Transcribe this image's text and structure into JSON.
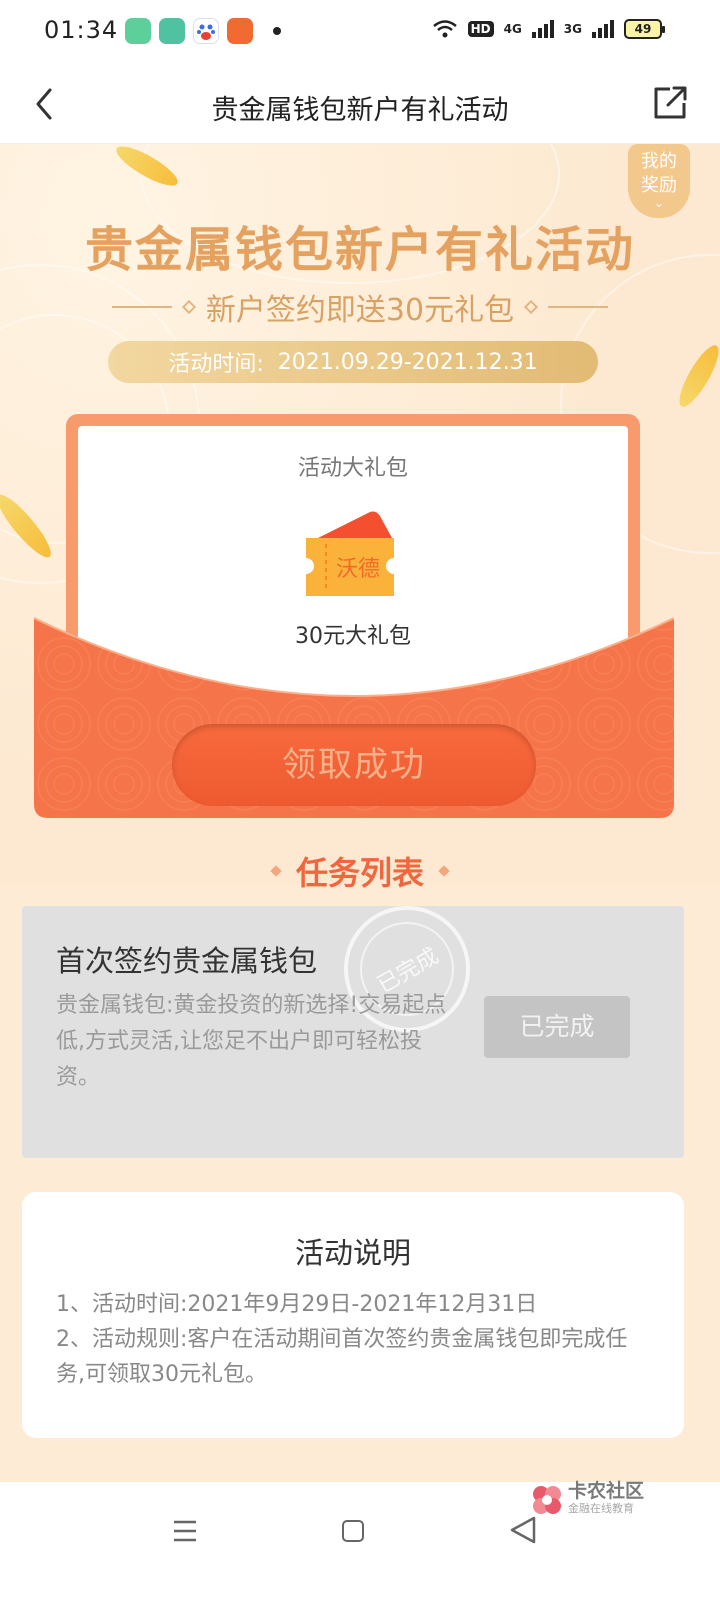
{
  "status_bar": {
    "time": "01:34",
    "hd": "HD",
    "net1": "4G",
    "net2": "3G",
    "battery": "49"
  },
  "title_bar": {
    "title": "贵金属钱包新户有礼活动"
  },
  "hero": {
    "my_reward": "我的奖励",
    "title": "贵金属钱包新户有礼活动",
    "subtitle": "新户签约即送30元礼包",
    "date_label": "活动时间:",
    "date_range": "2021.09.29-2021.12.31"
  },
  "gift_card": {
    "title": "活动大礼包",
    "ticket_text": "沃德",
    "gift_name": "30元大礼包",
    "claim_button": "领取成功"
  },
  "tasks": {
    "heading": "任务列表",
    "items": [
      {
        "title": "首次签约贵金属钱包",
        "desc": "贵金属钱包:黄金投资的新选择!交易起点低,方式灵活,让您足不出户即可轻松投资。",
        "button": "已完成",
        "stamp": "已完成"
      }
    ]
  },
  "rules": {
    "title": "活动说明",
    "lines": [
      "1、活动时间:2021年9月29日-2021年12月31日",
      "2、活动规则:客户在活动期间首次签约贵金属钱包即完成任务,可领取30元礼包。"
    ]
  },
  "watermark": {
    "main": "卡农社区",
    "sub": "金融在线教育"
  },
  "colors": {
    "accent": "#f0663e",
    "gold": "#e5a15f",
    "background": "#fdebd6"
  }
}
